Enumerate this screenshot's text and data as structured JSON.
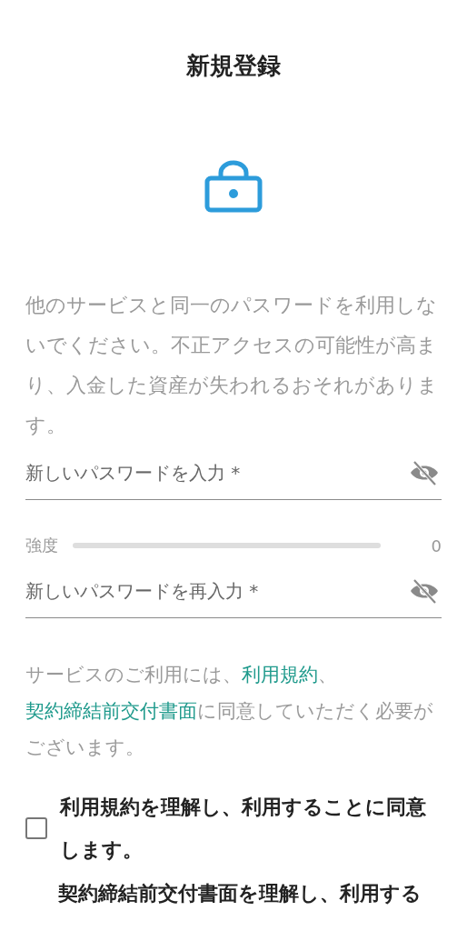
{
  "header": {
    "title": "新規登録"
  },
  "notice": "他のサービスと同一のパスワードを利用しないでください。不正アクセスの可能性が高まり、入金した資産が失われるおそれがあります。",
  "password_field": {
    "placeholder": "新しいパスワードを入力 *",
    "visible": false
  },
  "strength": {
    "label": "強度",
    "level": 0,
    "reading": "0"
  },
  "confirm_field": {
    "placeholder": "新しいパスワードを再入力 *",
    "visible": false
  },
  "terms": [
    {
      "kind": "text",
      "text": "サービスのご利用には、"
    },
    {
      "kind": "link",
      "text": "利用規約"
    },
    {
      "kind": "text",
      "text": "、"
    },
    {
      "kind": "link",
      "text": "契約締結前交付書面"
    },
    {
      "kind": "text",
      "text": "に同意していただく必要がございます。"
    }
  ],
  "agreements": [
    {
      "kind": "checkbox",
      "text": "利用規約を理解し、利用することに同意します。",
      "checked": false
    },
    {
      "kind": "partial",
      "text": "契約締結前交付書面を理解し、利用する"
    }
  ]
}
